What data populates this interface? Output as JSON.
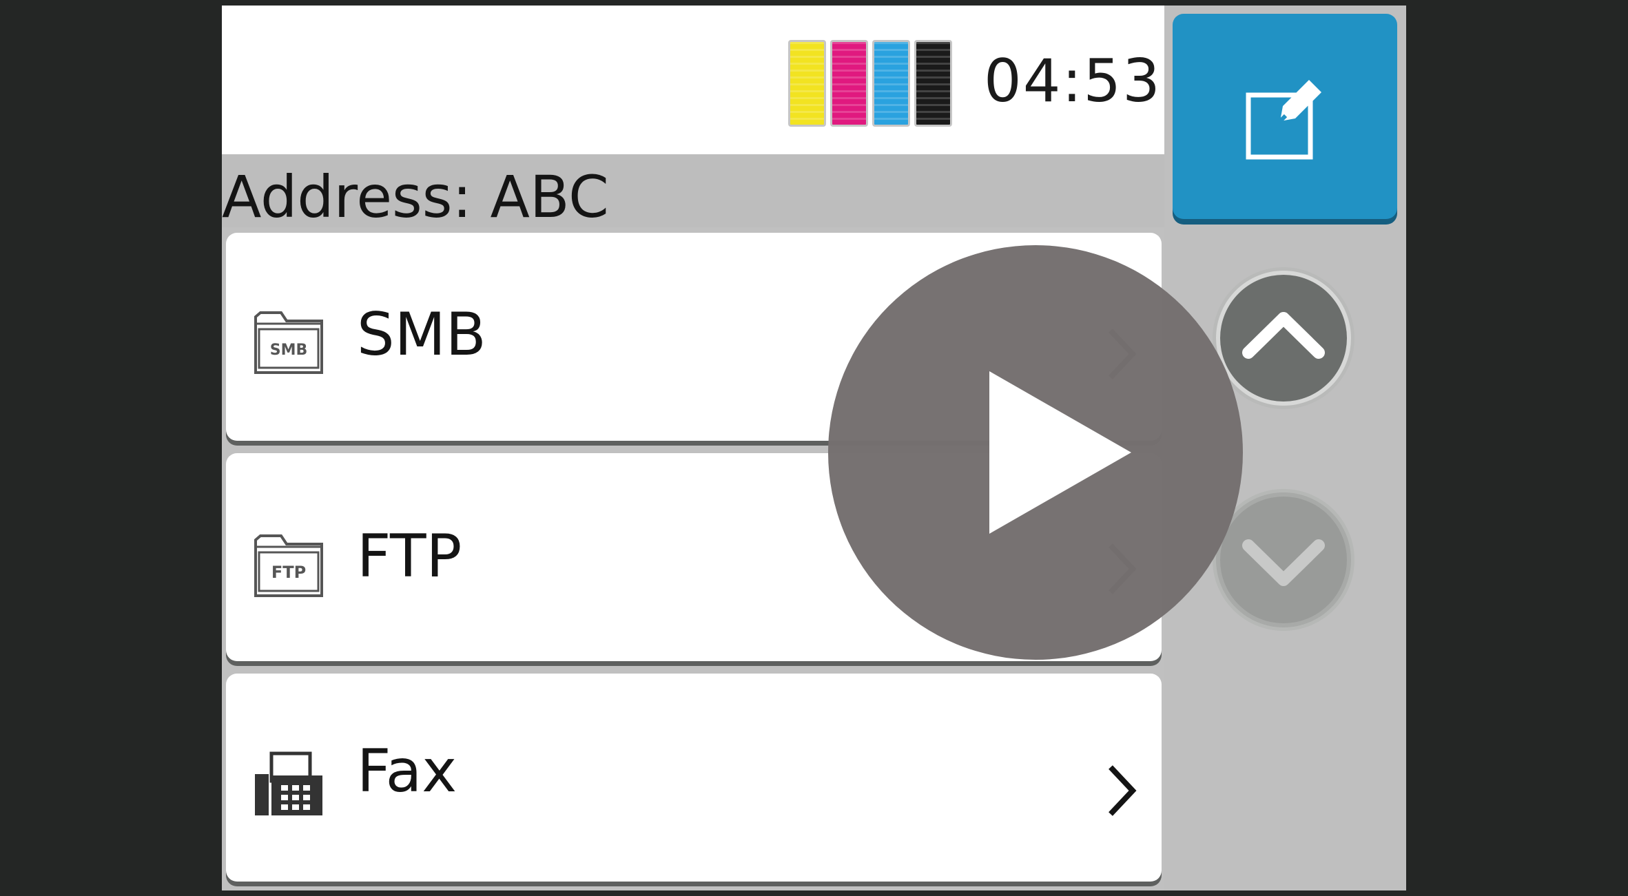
{
  "status": {
    "time": "04:53",
    "ink_colors": [
      "#f2e321",
      "#e0197f",
      "#2aa2df",
      "#1a1a1a"
    ]
  },
  "address": {
    "label": "Address: ABC"
  },
  "destinations": [
    {
      "label": "SMB",
      "icon": "smb-folder-icon",
      "icon_text": "SMB"
    },
    {
      "label": "FTP",
      "icon": "ftp-folder-icon",
      "icon_text": "FTP"
    },
    {
      "label": "Fax",
      "icon": "fax-icon"
    }
  ],
  "side_panel": {
    "edit_icon": "edit-icon",
    "up_icon": "chevron-up-icon",
    "down_icon": "chevron-down-icon",
    "accent_color": "#2192c4"
  },
  "overlay": {
    "icon": "play-icon"
  }
}
